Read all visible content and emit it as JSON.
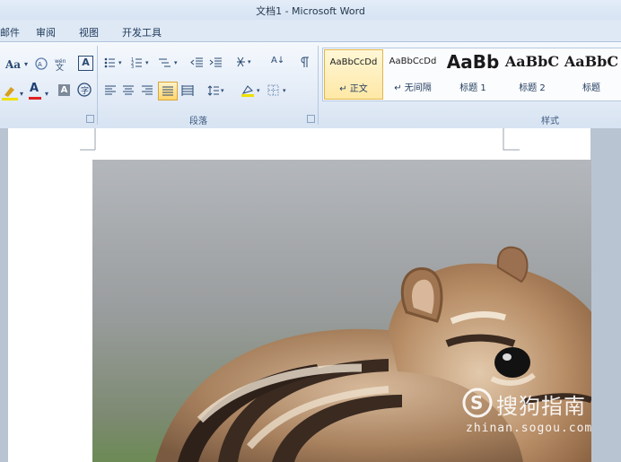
{
  "window": {
    "title": "文档1 - Microsoft Word"
  },
  "tabs": {
    "partial": "邮件",
    "review": "审阅",
    "view": "视图",
    "developer": "开发工具"
  },
  "font_group": {
    "change_case": "Aa",
    "font_color_letter": "A",
    "char_shading_letter": "A",
    "phonetic_letter": "ăr"
  },
  "paragraph_group": {
    "label": "段落",
    "sort_label": "A↓"
  },
  "styles_group": {
    "label": "样式",
    "items": [
      {
        "sample": "AaBbCcDd",
        "name": "↵ 正文",
        "selected": true
      },
      {
        "sample": "AaBbCcDd",
        "name": "↵ 无间隔",
        "selected": false
      },
      {
        "sample": "AaBb",
        "name": "标题 1",
        "selected": false
      },
      {
        "sample": "AaBbC",
        "name": "标题 2",
        "selected": false
      },
      {
        "sample": "AaBbC",
        "name": "标题",
        "selected": false
      }
    ]
  },
  "watermark": {
    "brand": "搜狗指南",
    "url": "zhinan.sogou.com"
  },
  "colors": {
    "ribbon_top": "#f5f9fd",
    "selected_style": "#ffe8a6",
    "font_color_bar": "#e02020",
    "highlight_bar": "#f0e000"
  }
}
